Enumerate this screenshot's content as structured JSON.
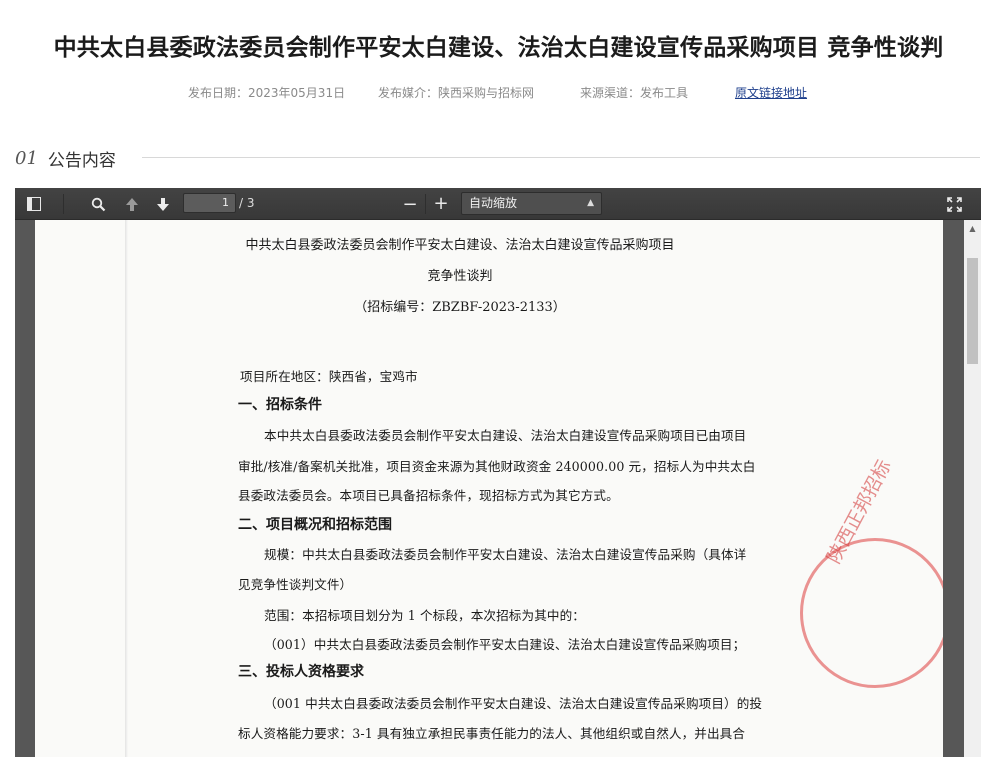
{
  "header": {
    "title": "中共太白县委政法委员会制作平安太白建设、法治太白建设宣传品采购项目 竞争性谈判",
    "meta": {
      "publish_date": "发布日期：2023年05月31日",
      "publish_media": "发布媒介：陕西采购与招标网",
      "source_channel": "来源渠道：发布工具",
      "original_link": "原文链接地址"
    }
  },
  "section": {
    "number": "01",
    "title": "公告内容"
  },
  "viewer": {
    "toolbar": {
      "sidebar_toggle_icon": "sidebar-toggle-icon",
      "search_icon": "search-icon",
      "prev_icon": "arrow-up-icon",
      "next_icon": "arrow-down-icon",
      "page_current": "1",
      "page_total": "/ 3",
      "zoom_out": "−",
      "zoom_in": "+",
      "zoom_value": "自动缩放",
      "fullscreen_icon": "fullscreen-icon"
    },
    "document": {
      "title_line1": "中共太白县委政法委员会制作平安太白建设、法治太白建设宣传品采购项目",
      "title_line2": "竞争性谈判",
      "bid_number": "（招标编号：ZBZBF-2023-2133）",
      "location": "项目所在地区：陕西省，宝鸡市",
      "h1": "一、招标条件",
      "p1_l1": "本中共太白县委政法委员会制作平安太白建设、法治太白建设宣传品采购项目已由项目",
      "p1_l2": "审批/核准/备案机关批准，项目资金来源为其他财政资金 240000.00 元，招标人为中共太白",
      "p1_l3": "县委政法委员会。本项目已具备招标条件，现招标方式为其它方式。",
      "h2": "二、项目概况和招标范围",
      "p2_l1": "规模：中共太白县委政法委员会制作平安太白建设、法治太白建设宣传品采购（具体详",
      "p2_l2": "见竞争性谈判文件）",
      "p2_l3": "范围：本招标项目划分为 1 个标段，本次招标为其中的：",
      "p2_l4": "（001）中共太白县委政法委员会制作平安太白建设、法治太白建设宣传品采购项目；",
      "h3": "三、投标人资格要求",
      "p3_l1": "（001 中共太白县委政法委员会制作平安太白建设、法治太白建设宣传品采购项目）的投",
      "p3_l2": "标人资格能力要求：3-1 具有独立承担民事责任能力的法人、其他组织或自然人，并出具合",
      "stamp_text": "陕西正邦招标"
    }
  }
}
